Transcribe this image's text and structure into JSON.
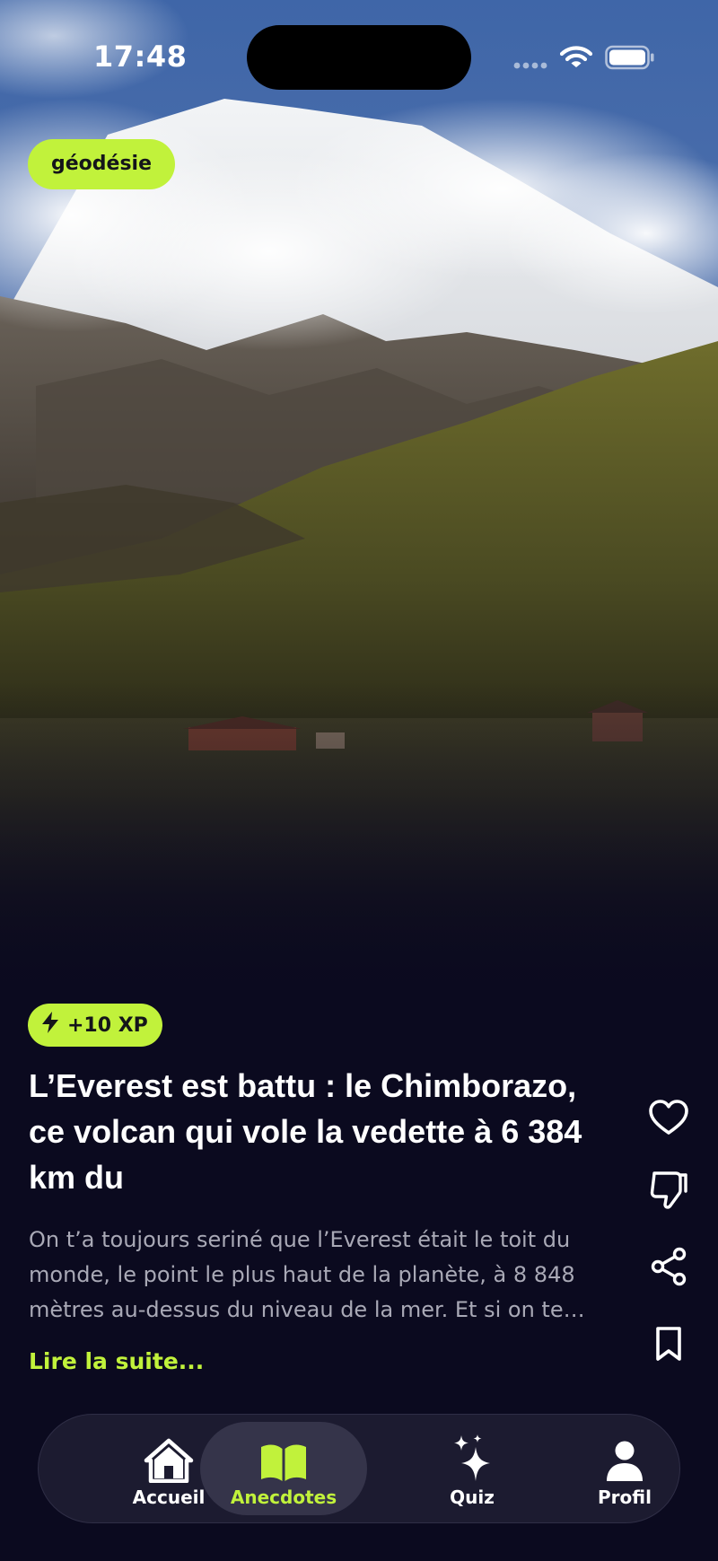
{
  "status_bar": {
    "time": "17:48"
  },
  "story": {
    "category": "géodésie",
    "xp": "+10 XP",
    "title": "L’Everest est battu : le Chimborazo, ce volcan qui vole la vedette à 6 384 km du",
    "excerpt": "On t’a toujours seriné que l’Everest était le toit du monde, le point le plus haut de la planète, à 8 848 mètres au-dessus du niveau de la mer. Et si on te…",
    "read_more": "Lire la suite..."
  },
  "actions": [
    {
      "icon": "heart-icon"
    },
    {
      "icon": "thumbs-down-icon"
    },
    {
      "icon": "share-icon"
    },
    {
      "icon": "bookmark-icon"
    }
  ],
  "tabbar": {
    "tabs": [
      {
        "label": "Accueil",
        "icon": "home-icon",
        "active": false
      },
      {
        "label": "Anecdotes",
        "icon": "book-open-icon",
        "active": true
      },
      {
        "label": "Quiz",
        "icon": "sparkles-icon",
        "active": false
      },
      {
        "label": "Profil",
        "icon": "person-icon",
        "active": false
      }
    ]
  },
  "colors": {
    "accent": "#c1f23b",
    "background": "#0b0a1f",
    "tabbar": "#1c1b30",
    "active_tab": "#35344a",
    "excerpt_text": "#a9a9b6"
  }
}
